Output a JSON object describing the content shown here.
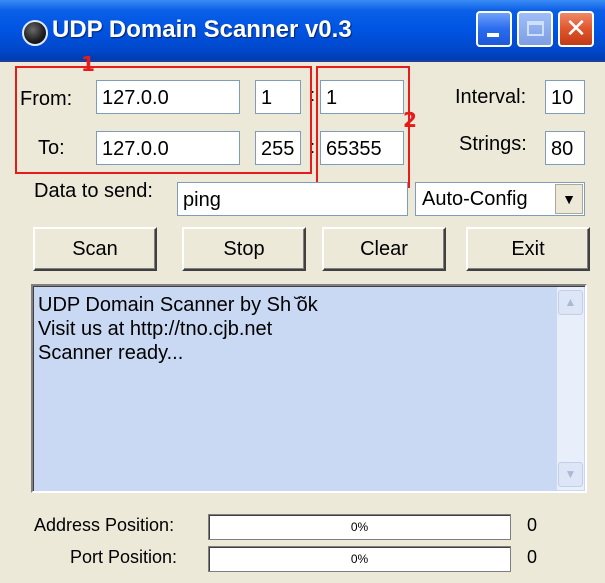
{
  "window": {
    "title": "UDP Domain Scanner v0.3"
  },
  "range": {
    "from_label": "From:",
    "from_ip": "127.0.0",
    "from_octet": "1",
    "to_label": "To:",
    "to_ip": "127.0.0",
    "to_octet": "255"
  },
  "ports": {
    "start": "1",
    "end": "65355"
  },
  "settings": {
    "interval_label": "Interval:",
    "interval_value": "10",
    "strings_label": "Strings:",
    "strings_value": "80"
  },
  "data_to_send": {
    "label": "Data to send:",
    "value": "ping",
    "mode_selected": "Auto-Config"
  },
  "buttons": {
    "scan": "Scan",
    "stop": "Stop",
    "clear": "Clear",
    "exit": "Exit"
  },
  "log": {
    "lines": [
      "UDP Domain Scanner by Sh ̆õk",
      "Visit us at http://tno.cjb.net",
      "Scanner ready..."
    ]
  },
  "progress": {
    "address_label": "Address Position:",
    "address_percent_text": "0%",
    "address_fraction": 0,
    "address_count": "0",
    "port_label": "Port Position:",
    "port_percent_text": "0%",
    "port_fraction": 0,
    "port_count": "0"
  },
  "annotations": {
    "box1_number": "1",
    "box2_number": "2",
    "color": "#e81b1b"
  },
  "colors": {
    "titlebar": "#0054e3",
    "window_bg": "#ece9d8",
    "log_bg": "#c9d9f3"
  }
}
